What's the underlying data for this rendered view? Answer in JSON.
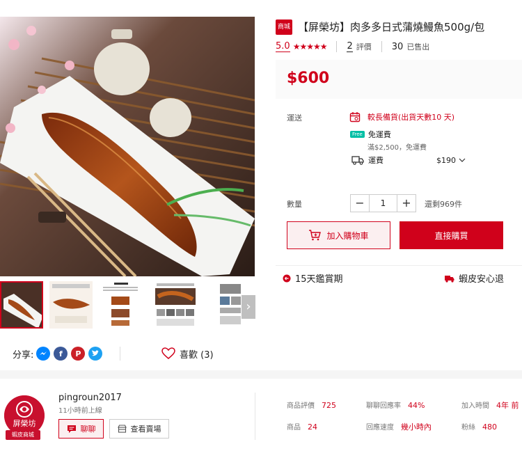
{
  "product": {
    "mall_badge": "商城",
    "title": "【屏榮坊】肉多多日式蒲燒鰻魚500g/包",
    "rating_score": "5.0",
    "stars": "★★★★★",
    "rating_count": "2",
    "rating_label": "評價",
    "sold_count": "30",
    "sold_label": "已售出",
    "price": "$600"
  },
  "shipping": {
    "label": "運送",
    "ship_date": "較長備貨(出貨天數10 天)",
    "free_tag": "Free",
    "free_label": "免運費",
    "free_condition": "滿$2,500，免運費",
    "fee_label": "運費",
    "fee_amount": "$190"
  },
  "purchase": {
    "qty_label": "數量",
    "qty_value": "1",
    "minus": "−",
    "plus": "+",
    "stock": "還剩969件",
    "add_to_cart": "加入購物車",
    "buy_now": "直接購買"
  },
  "guarantees": {
    "return_policy": "15天鑑賞期",
    "shopee_guarantee": "蝦皮安心退"
  },
  "gallery": {
    "next_arrow": "›"
  },
  "social": {
    "share_label": "分享:",
    "like_label": "喜歡 (3)"
  },
  "shop": {
    "name": "pingroun2017",
    "status": "11小時前上線",
    "avatar_text": "屏榮坊",
    "avatar_badge": "蝦皮商城",
    "chat_label": "聊聊",
    "view_shop_label": "查看賣場",
    "stats": [
      {
        "label": "商品評價",
        "value": "725"
      },
      {
        "label": "聊聊回應率",
        "value": "44%"
      },
      {
        "label": "加入時間",
        "value": "4年 前"
      },
      {
        "label": "商品",
        "value": "24"
      },
      {
        "label": "回應速度",
        "value": "幾小時內"
      },
      {
        "label": "粉絲",
        "value": "480"
      }
    ]
  },
  "colors": {
    "brand": "#d0011b",
    "free_ship": "#00bfa5",
    "messenger": "#0084ff",
    "facebook": "#3b5998",
    "pinterest": "#cb2027",
    "twitter": "#1da1f2"
  }
}
